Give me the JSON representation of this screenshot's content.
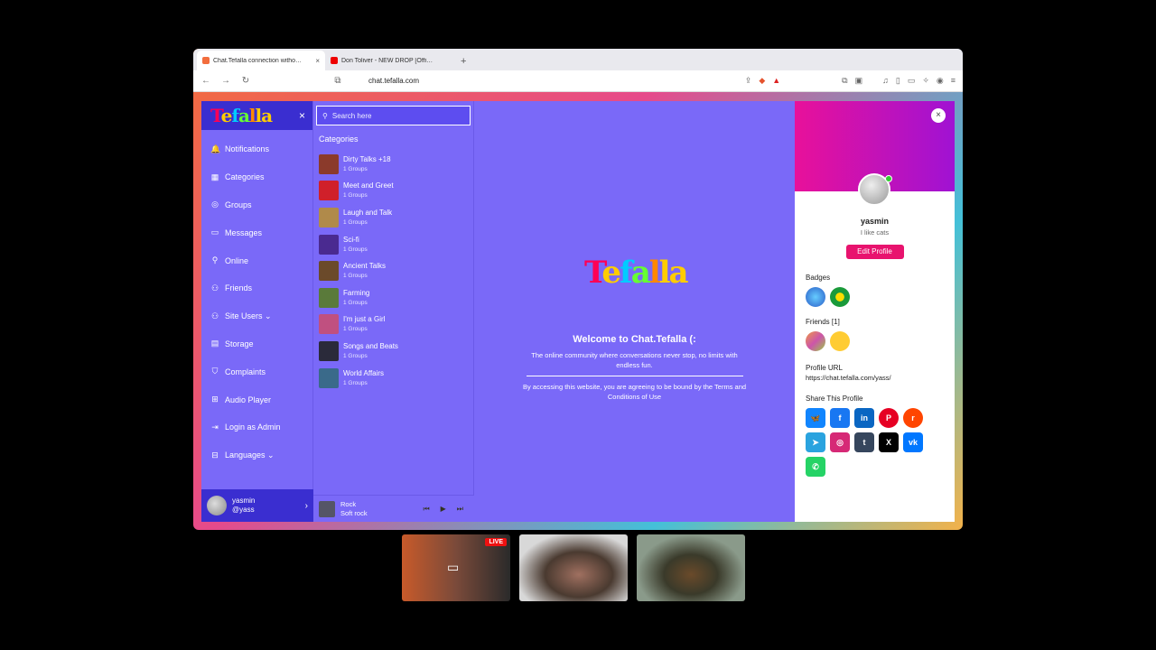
{
  "browser": {
    "tabs": [
      {
        "title": "Chat.Tefalla connection witho…",
        "active": true,
        "favicon_color": "#f26d3d"
      },
      {
        "title": "Don Toliver - NEW DROP [Offi…",
        "active": false,
        "favicon_color": "#e00"
      }
    ],
    "newtab": "+",
    "url": "chat.tefalla.com",
    "nav": {
      "back": "←",
      "forward": "→",
      "reload": "↻",
      "bookmark": "⧉"
    }
  },
  "sidebar": {
    "logo": [
      "T",
      "e",
      "f",
      "a",
      "l",
      "la"
    ],
    "close": "×",
    "items": [
      {
        "icon": "bell-icon",
        "glyph": "🔔",
        "label": "Notifications"
      },
      {
        "icon": "grid-icon",
        "glyph": "▦",
        "label": "Categories"
      },
      {
        "icon": "groups-icon",
        "glyph": "◎",
        "label": "Groups"
      },
      {
        "icon": "messages-icon",
        "glyph": "▭",
        "label": "Messages"
      },
      {
        "icon": "online-icon",
        "glyph": "⚲",
        "label": "Online"
      },
      {
        "icon": "friends-icon",
        "glyph": "⚇",
        "label": "Friends"
      },
      {
        "icon": "site-users-icon",
        "glyph": "⚇",
        "label": "Site Users ⌄"
      },
      {
        "icon": "storage-icon",
        "glyph": "▤",
        "label": "Storage"
      },
      {
        "icon": "complaints-icon",
        "glyph": "⛉",
        "label": "Complaints"
      },
      {
        "icon": "audio-icon",
        "glyph": "⊞",
        "label": "Audio Player"
      },
      {
        "icon": "login-icon",
        "glyph": "⇥",
        "label": "Login as Admin"
      },
      {
        "icon": "languages-icon",
        "glyph": "⊟",
        "label": "Languages ⌄"
      }
    ],
    "user": {
      "name": "yasmin",
      "handle": "@yass",
      "chev": "›"
    }
  },
  "categories": {
    "search_placeholder": "Search here",
    "title": "Categories",
    "items": [
      {
        "name": "Dirty Talks +18",
        "count": "1 Groups",
        "color": "#8b3a2b"
      },
      {
        "name": "Meet and Greet",
        "count": "1 Groups",
        "color": "#d0202a"
      },
      {
        "name": "Laugh and Talk",
        "count": "1 Groups",
        "color": "#b08a4a"
      },
      {
        "name": "Sci-fi",
        "count": "1 Groups",
        "color": "#4a2a90"
      },
      {
        "name": "Ancient Talks",
        "count": "1 Groups",
        "color": "#6b4a2a"
      },
      {
        "name": "Farming",
        "count": "1 Groups",
        "color": "#5a7a3a"
      },
      {
        "name": "I'm just a Girl",
        "count": "1 Groups",
        "color": "#c05080"
      },
      {
        "name": "Songs and Beats",
        "count": "1 Groups",
        "color": "#2a2a3a"
      },
      {
        "name": "World Affairs",
        "count": "1 Groups",
        "color": "#3a6a8a"
      }
    ],
    "player": {
      "track": "Rock",
      "genre": "Soft rock",
      "prev": "⏮",
      "play": "▶",
      "next": "⏭"
    }
  },
  "main": {
    "logo": [
      "T",
      "e",
      "f",
      "a",
      "l",
      "la"
    ],
    "welcome_title": "Welcome to Chat.Tefalla (:",
    "tagline": "The online community where conversations never stop, no limits with endless fun.",
    "terms": "By accessing this website, you are agreeing to be bound by the Terms and Conditions of Use"
  },
  "profile": {
    "close": "×",
    "name": "yasmin",
    "bio": "I like cats",
    "edit_label": "Edit Profile",
    "badges_label": "Badges",
    "friends_label": "Friends [1]",
    "url_label": "Profile URL",
    "url": "https://chat.tefalla.com/yass/",
    "share_label": "Share This Profile",
    "share": [
      {
        "name": "bluesky-icon",
        "glyph": "🦋",
        "color": "#1185fe"
      },
      {
        "name": "facebook-icon",
        "glyph": "f",
        "color": "#1877f2"
      },
      {
        "name": "linkedin-icon",
        "glyph": "in",
        "color": "#0a66c2"
      },
      {
        "name": "pinterest-icon",
        "glyph": "P",
        "color": "#e60023"
      },
      {
        "name": "reddit-icon",
        "glyph": "r",
        "color": "#ff4500"
      },
      {
        "name": "telegram-icon",
        "glyph": "➤",
        "color": "#2aa3df"
      },
      {
        "name": "instagram-icon",
        "glyph": "◎",
        "color": "#d62976"
      },
      {
        "name": "tumblr-icon",
        "glyph": "t",
        "color": "#36465d"
      },
      {
        "name": "x-icon",
        "glyph": "X",
        "color": "#000000"
      },
      {
        "name": "vk-icon",
        "glyph": "vk",
        "color": "#0077ff"
      },
      {
        "name": "whatsapp-icon",
        "glyph": "✆",
        "color": "#25d366"
      }
    ]
  },
  "videos": {
    "live_label": "LIVE"
  }
}
